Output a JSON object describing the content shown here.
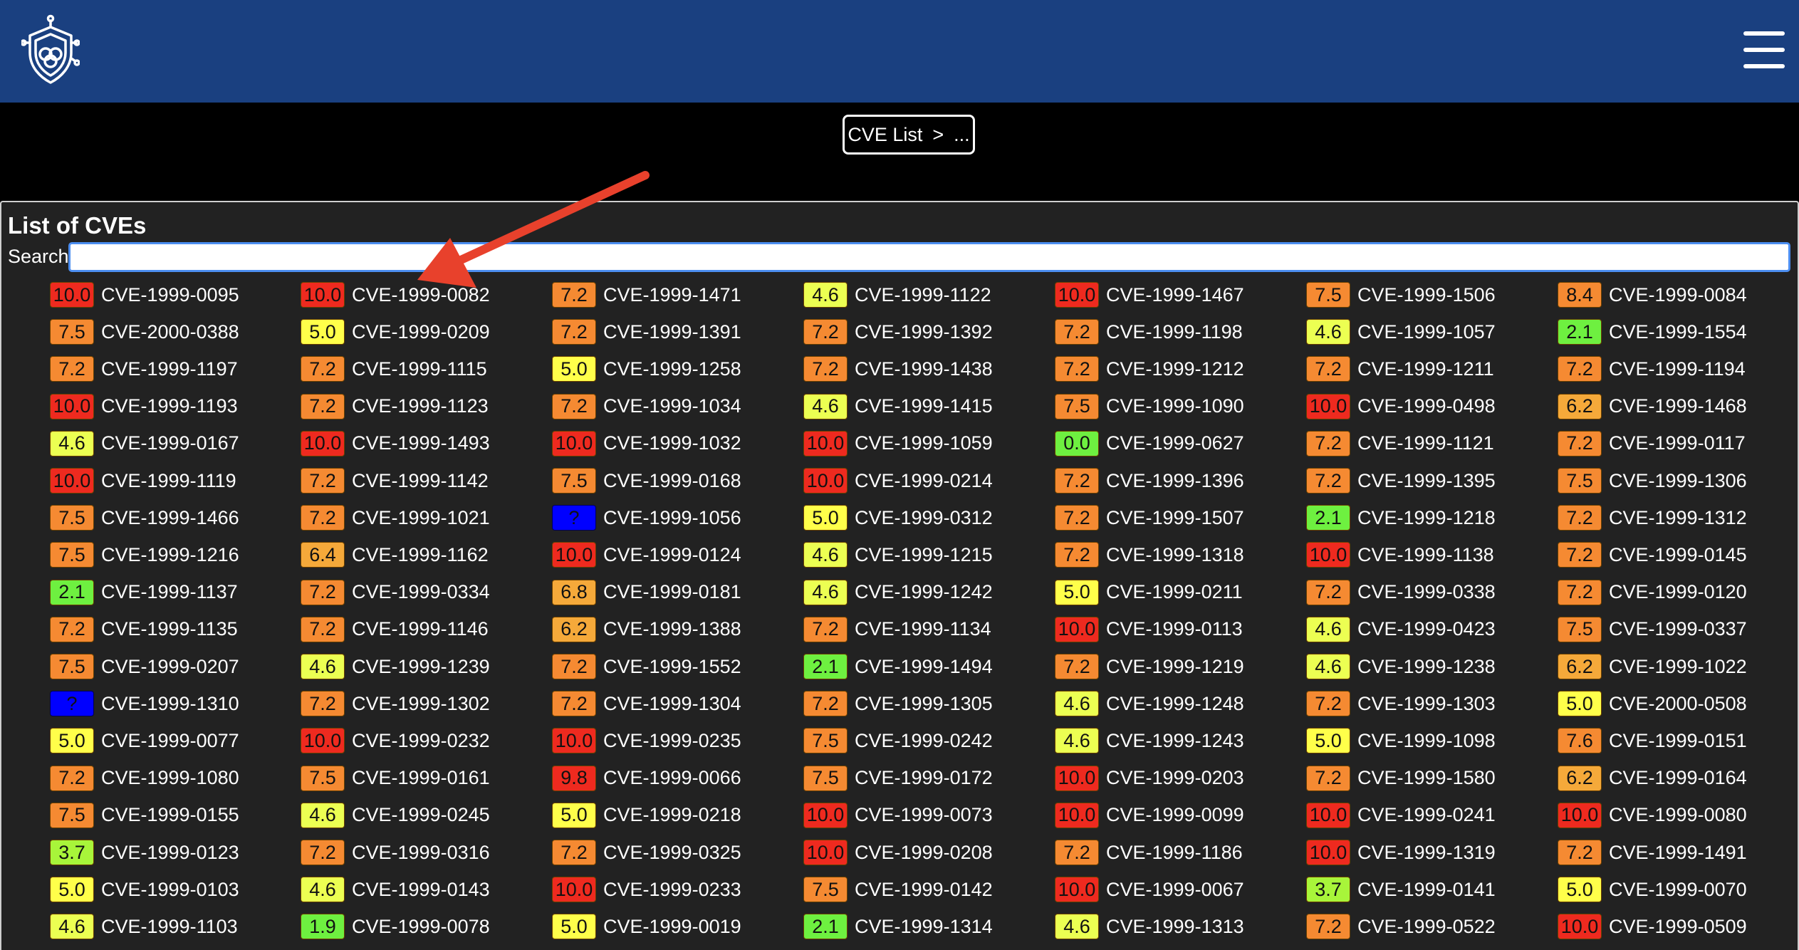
{
  "breadcrumb": {
    "root": "CVE List",
    "separator": ">",
    "current": "..."
  },
  "panel": {
    "title": "List of CVEs",
    "search_label": "Search",
    "search_value": ""
  },
  "colors": {
    "header": "#1a4080",
    "page": "#000000",
    "panel": "#222222",
    "score_critical": "#ee2a1f",
    "score_high": "#f58a32",
    "score_high_light": "#f5a93a",
    "score_medium": "#ffff4a",
    "score_medium_low": "#ecff52",
    "score_low": "#a8f53a",
    "score_none": "#6ef040",
    "score_unknown": "#0000ff",
    "arrow": "#e8412c"
  },
  "icons": {
    "logo": "shield-brain-logo-icon",
    "menu": "hamburger-menu-icon",
    "annotation": "red-arrow-annotation"
  },
  "cves": [
    [
      [
        "10.0",
        "CVE-1999-0095"
      ],
      [
        "10.0",
        "CVE-1999-0082"
      ],
      [
        "7.2",
        "CVE-1999-1471"
      ],
      [
        "4.6",
        "CVE-1999-1122"
      ],
      [
        "10.0",
        "CVE-1999-1467"
      ],
      [
        "7.5",
        "CVE-1999-1506"
      ],
      [
        "8.4",
        "CVE-1999-0084"
      ]
    ],
    [
      [
        "7.5",
        "CVE-2000-0388"
      ],
      [
        "5.0",
        "CVE-1999-0209"
      ],
      [
        "7.2",
        "CVE-1999-1391"
      ],
      [
        "7.2",
        "CVE-1999-1392"
      ],
      [
        "7.2",
        "CVE-1999-1198"
      ],
      [
        "4.6",
        "CVE-1999-1057"
      ],
      [
        "2.1",
        "CVE-1999-1554"
      ]
    ],
    [
      [
        "7.2",
        "CVE-1999-1197"
      ],
      [
        "7.2",
        "CVE-1999-1115"
      ],
      [
        "5.0",
        "CVE-1999-1258"
      ],
      [
        "7.2",
        "CVE-1999-1438"
      ],
      [
        "7.2",
        "CVE-1999-1212"
      ],
      [
        "7.2",
        "CVE-1999-1211"
      ],
      [
        "7.2",
        "CVE-1999-1194"
      ]
    ],
    [
      [
        "10.0",
        "CVE-1999-1193"
      ],
      [
        "7.2",
        "CVE-1999-1123"
      ],
      [
        "7.2",
        "CVE-1999-1034"
      ],
      [
        "4.6",
        "CVE-1999-1415"
      ],
      [
        "7.5",
        "CVE-1999-1090"
      ],
      [
        "10.0",
        "CVE-1999-0498"
      ],
      [
        "6.2",
        "CVE-1999-1468"
      ]
    ],
    [
      [
        "4.6",
        "CVE-1999-0167"
      ],
      [
        "10.0",
        "CVE-1999-1493"
      ],
      [
        "10.0",
        "CVE-1999-1032"
      ],
      [
        "10.0",
        "CVE-1999-1059"
      ],
      [
        "0.0",
        "CVE-1999-0627"
      ],
      [
        "7.2",
        "CVE-1999-1121"
      ],
      [
        "7.2",
        "CVE-1999-0117"
      ]
    ],
    [
      [
        "10.0",
        "CVE-1999-1119"
      ],
      [
        "7.2",
        "CVE-1999-1142"
      ],
      [
        "7.5",
        "CVE-1999-0168"
      ],
      [
        "10.0",
        "CVE-1999-0214"
      ],
      [
        "7.2",
        "CVE-1999-1396"
      ],
      [
        "7.2",
        "CVE-1999-1395"
      ],
      [
        "7.5",
        "CVE-1999-1306"
      ]
    ],
    [
      [
        "7.5",
        "CVE-1999-1466"
      ],
      [
        "7.2",
        "CVE-1999-1021"
      ],
      [
        "?",
        "CVE-1999-1056"
      ],
      [
        "5.0",
        "CVE-1999-0312"
      ],
      [
        "7.2",
        "CVE-1999-1507"
      ],
      [
        "2.1",
        "CVE-1999-1218"
      ],
      [
        "7.2",
        "CVE-1999-1312"
      ]
    ],
    [
      [
        "7.5",
        "CVE-1999-1216"
      ],
      [
        "6.4",
        "CVE-1999-1162"
      ],
      [
        "10.0",
        "CVE-1999-0124"
      ],
      [
        "4.6",
        "CVE-1999-1215"
      ],
      [
        "7.2",
        "CVE-1999-1318"
      ],
      [
        "10.0",
        "CVE-1999-1138"
      ],
      [
        "7.2",
        "CVE-1999-0145"
      ]
    ],
    [
      [
        "2.1",
        "CVE-1999-1137"
      ],
      [
        "7.2",
        "CVE-1999-0334"
      ],
      [
        "6.8",
        "CVE-1999-0181"
      ],
      [
        "4.6",
        "CVE-1999-1242"
      ],
      [
        "5.0",
        "CVE-1999-0211"
      ],
      [
        "7.2",
        "CVE-1999-0338"
      ],
      [
        "7.2",
        "CVE-1999-0120"
      ]
    ],
    [
      [
        "7.2",
        "CVE-1999-1135"
      ],
      [
        "7.2",
        "CVE-1999-1146"
      ],
      [
        "6.2",
        "CVE-1999-1388"
      ],
      [
        "7.2",
        "CVE-1999-1134"
      ],
      [
        "10.0",
        "CVE-1999-0113"
      ],
      [
        "4.6",
        "CVE-1999-0423"
      ],
      [
        "7.5",
        "CVE-1999-0337"
      ]
    ],
    [
      [
        "7.5",
        "CVE-1999-0207"
      ],
      [
        "4.6",
        "CVE-1999-1239"
      ],
      [
        "7.2",
        "CVE-1999-1552"
      ],
      [
        "2.1",
        "CVE-1999-1494"
      ],
      [
        "7.2",
        "CVE-1999-1219"
      ],
      [
        "4.6",
        "CVE-1999-1238"
      ],
      [
        "6.2",
        "CVE-1999-1022"
      ]
    ],
    [
      [
        "?",
        "CVE-1999-1310"
      ],
      [
        "7.2",
        "CVE-1999-1302"
      ],
      [
        "7.2",
        "CVE-1999-1304"
      ],
      [
        "7.2",
        "CVE-1999-1305"
      ],
      [
        "4.6",
        "CVE-1999-1248"
      ],
      [
        "7.2",
        "CVE-1999-1303"
      ],
      [
        "5.0",
        "CVE-2000-0508"
      ]
    ],
    [
      [
        "5.0",
        "CVE-1999-0077"
      ],
      [
        "10.0",
        "CVE-1999-0232"
      ],
      [
        "10.0",
        "CVE-1999-0235"
      ],
      [
        "7.5",
        "CVE-1999-0242"
      ],
      [
        "4.6",
        "CVE-1999-1243"
      ],
      [
        "5.0",
        "CVE-1999-1098"
      ],
      [
        "7.6",
        "CVE-1999-0151"
      ]
    ],
    [
      [
        "7.2",
        "CVE-1999-1080"
      ],
      [
        "7.5",
        "CVE-1999-0161"
      ],
      [
        "9.8",
        "CVE-1999-0066"
      ],
      [
        "7.5",
        "CVE-1999-0172"
      ],
      [
        "10.0",
        "CVE-1999-0203"
      ],
      [
        "7.2",
        "CVE-1999-1580"
      ],
      [
        "6.2",
        "CVE-1999-0164"
      ]
    ],
    [
      [
        "7.5",
        "CVE-1999-0155"
      ],
      [
        "4.6",
        "CVE-1999-0245"
      ],
      [
        "5.0",
        "CVE-1999-0218"
      ],
      [
        "10.0",
        "CVE-1999-0073"
      ],
      [
        "10.0",
        "CVE-1999-0099"
      ],
      [
        "10.0",
        "CVE-1999-0241"
      ],
      [
        "10.0",
        "CVE-1999-0080"
      ]
    ],
    [
      [
        "3.7",
        "CVE-1999-0123"
      ],
      [
        "7.2",
        "CVE-1999-0316"
      ],
      [
        "7.2",
        "CVE-1999-0325"
      ],
      [
        "10.0",
        "CVE-1999-0208"
      ],
      [
        "7.2",
        "CVE-1999-1186"
      ],
      [
        "10.0",
        "CVE-1999-1319"
      ],
      [
        "7.2",
        "CVE-1999-1491"
      ]
    ],
    [
      [
        "5.0",
        "CVE-1999-0103"
      ],
      [
        "4.6",
        "CVE-1999-0143"
      ],
      [
        "10.0",
        "CVE-1999-0233"
      ],
      [
        "7.5",
        "CVE-1999-0142"
      ],
      [
        "10.0",
        "CVE-1999-0067"
      ],
      [
        "3.7",
        "CVE-1999-0141"
      ],
      [
        "5.0",
        "CVE-1999-0070"
      ]
    ],
    [
      [
        "4.6",
        "CVE-1999-1103"
      ],
      [
        "1.9",
        "CVE-1999-0078"
      ],
      [
        "5.0",
        "CVE-1999-0019"
      ],
      [
        "2.1",
        "CVE-1999-1314"
      ],
      [
        "4.6",
        "CVE-1999-1313"
      ],
      [
        "7.2",
        "CVE-1999-0522"
      ],
      [
        "10.0",
        "CVE-1999-0509"
      ]
    ]
  ]
}
